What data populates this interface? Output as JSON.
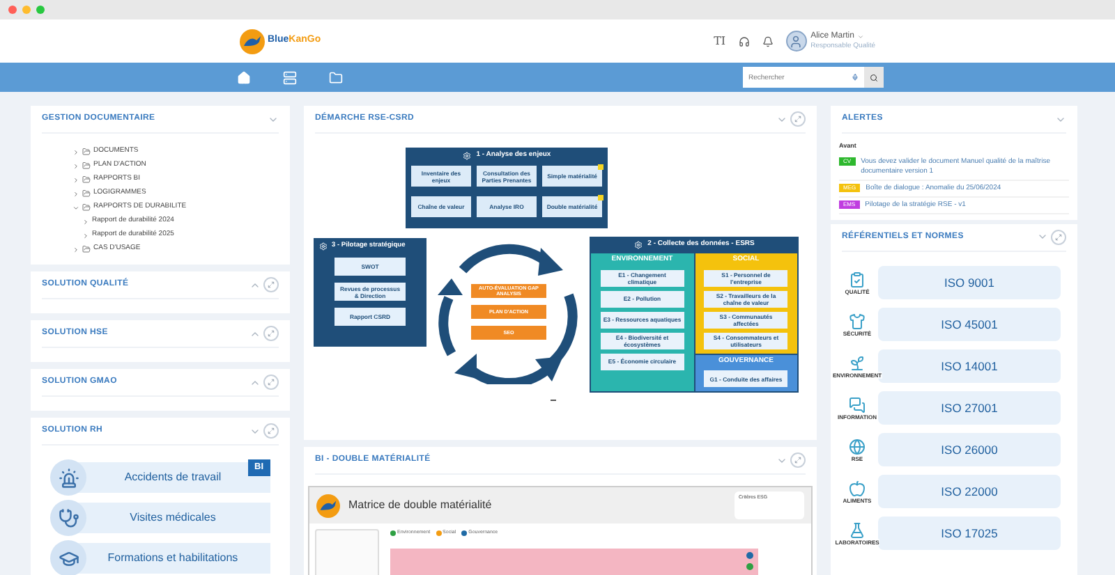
{
  "header": {
    "logo_parts": [
      "Blue",
      "KanGo"
    ],
    "font_tool": "TI",
    "user": {
      "name": "Alice Martin",
      "role": "Responsable Qualité"
    }
  },
  "nav": {
    "search": {
      "placeholder": "Rechercher"
    }
  },
  "left_panels": [
    {
      "title": "GESTION DOCUMENTAIRE",
      "collapsed": false,
      "maximizable": false,
      "kind": "tree",
      "tree": [
        {
          "label": "DOCUMENTS",
          "kind": "folder",
          "expanded": false
        },
        {
          "label": "PLAN D'ACTION",
          "kind": "folder",
          "expanded": false
        },
        {
          "label": "RAPPORTS BI",
          "kind": "folder",
          "expanded": false
        },
        {
          "label": "LOGIGRAMMES",
          "kind": "folder",
          "expanded": false
        },
        {
          "label": "RAPPORTS DE DURABILITE",
          "kind": "folder",
          "expanded": true,
          "children": [
            {
              "label": "Rapport de durabilité 2024",
              "expanded": false
            },
            {
              "label": "Rapport de durabilité 2025",
              "expanded": false
            }
          ]
        },
        {
          "label": "CAS D'USAGE",
          "kind": "folder",
          "expanded": false
        }
      ]
    },
    {
      "title": "SOLUTION QUALITÉ",
      "collapsed": true,
      "maximizable": true,
      "kind": "empty"
    },
    {
      "title": "SOLUTION HSE",
      "collapsed": true,
      "maximizable": true,
      "kind": "empty"
    },
    {
      "title": "SOLUTION GMAO",
      "collapsed": true,
      "maximizable": true,
      "kind": "empty"
    },
    {
      "title": "SOLUTION RH",
      "collapsed": false,
      "maximizable": true,
      "kind": "tiles",
      "badge": "BI",
      "tiles": [
        "Accidents de travail",
        "Visites médicales",
        "Formations et habilitations"
      ]
    }
  ],
  "demarche": {
    "title": "DÉMARCHE RSE-CSRD",
    "collapsed": false,
    "maximizable": true,
    "analyse": {
      "title": "1 - Analyse des enjeux",
      "items": [
        {
          "label": "Inventaire des enjeux",
          "flagged": false
        },
        {
          "label": "Consultation des Parties Prenantes",
          "flagged": false
        },
        {
          "label": "Simple matérialité",
          "flagged": true
        },
        {
          "label": "Chaîne de valeur",
          "flagged": false
        },
        {
          "label": "Analyse IRO",
          "flagged": false
        },
        {
          "label": "Double matérialité",
          "flagged": true
        }
      ]
    },
    "pilotage": {
      "title": "3 - Pilotage stratégique",
      "items": [
        "SWOT",
        "Revues de processus & Direction",
        "Rapport CSRD"
      ]
    },
    "cycle": [
      "AUTO-ÉVALUATION GAP ANALYSIS",
      "PLAN D'ACTION",
      "SEO"
    ],
    "collecte": {
      "title": "2 - Collecte des données - ESRS",
      "groups": [
        {
          "title": "ENVIRONNEMENT",
          "color": "#2bb5ae",
          "items": [
            "E1 - Changement climatique",
            "E2 - Pollution",
            "E3 - Ressources aquatiques",
            "E4 - Biodiversité et écosystèmes",
            "E5 - Économie circulaire"
          ]
        },
        {
          "title": "SOCIAL",
          "color": "#f4c20d",
          "items": [
            "S1 - Personnel de l'entreprise",
            "S2 - Travailleurs de la chaîne de valeur",
            "S3 - Communautés affectées",
            "S4 - Consommateurs et utilisateurs"
          ]
        },
        {
          "title": "GOUVERNANCE",
          "color": "#4a90d9",
          "items": [
            "G1 - Conduite des affaires"
          ]
        }
      ]
    }
  },
  "bi": {
    "title": "BI - DOUBLE MATÉRIALITÉ",
    "collapsed": false,
    "maximizable": true,
    "report_title": "Matrice de double matérialité",
    "filter_label": "Critères ESG",
    "legend": [
      {
        "label": "Environnement",
        "color": "#2ea043"
      },
      {
        "label": "Social",
        "color": "#f39c12"
      },
      {
        "label": "Gouvernance",
        "color": "#1f6aa5"
      }
    ]
  },
  "alerts": {
    "title": "ALERTES",
    "collapsed": false,
    "group": "Avant",
    "items": [
      {
        "tag": "CV",
        "color": "#2eb82e",
        "text": "Vous devez valider le document Manuel qualité de la maîtrise documentaire version 1"
      },
      {
        "tag": "MEG",
        "color": "#f4c20d",
        "text": "Boîte de dialogue : Anomalie du 25/06/2024"
      },
      {
        "tag": "EMS",
        "color": "#c03de0",
        "text": "Pilotage de la stratégie RSE - v1"
      }
    ]
  },
  "normes": {
    "title": "RÉFÉRENTIELS ET NORMES",
    "collapsed": false,
    "maximizable": true,
    "items": [
      {
        "caption": "QUALITÉ",
        "label": "ISO 9001"
      },
      {
        "caption": "SÉCURITÉ",
        "label": "ISO 45001"
      },
      {
        "caption": "ENVIRONNEMENT",
        "label": "ISO 14001"
      },
      {
        "caption": "INFORMATION",
        "label": "ISO 27001"
      },
      {
        "caption": "RSE",
        "label": "ISO 26000"
      },
      {
        "caption": "ALIMENTS",
        "label": "ISO 22000"
      },
      {
        "caption": "LABORATOIRES",
        "label": "ISO 17025"
      }
    ]
  }
}
